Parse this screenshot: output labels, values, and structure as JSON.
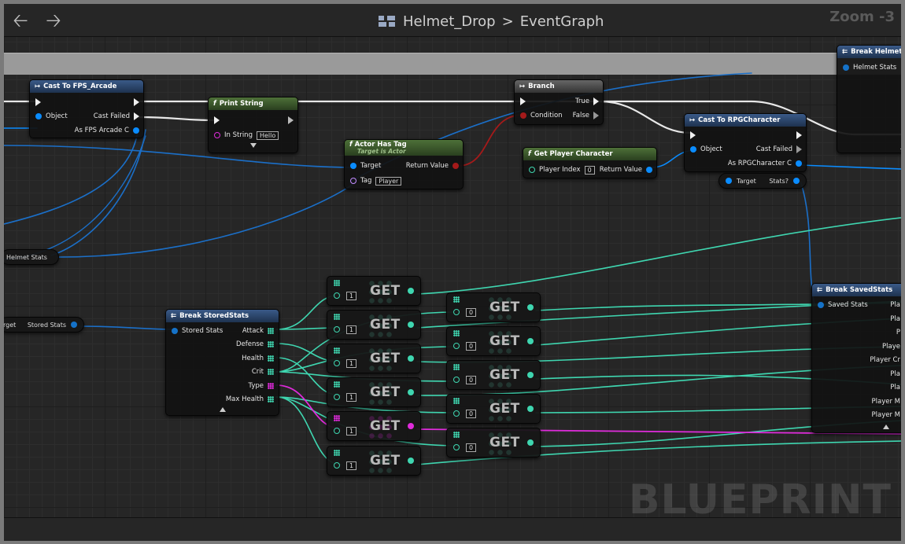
{
  "toolbar": {
    "back_icon": "back-arrow-icon",
    "forward_icon": "forward-arrow-icon",
    "graph_icon": "graph-icon",
    "asset_name": "Helmet_Drop",
    "separator": ">",
    "graph_name": "EventGraph",
    "zoom_label": "Zoom -3"
  },
  "colors": {
    "exec": "#f0f0f0",
    "object": "#0a8cff",
    "struct": "#1572c8",
    "integer": "#3fd6b0",
    "byte": "#e02bdc",
    "boolean": "#a51a1a",
    "string": "#e02bdc",
    "cast_header": "#2c4a74",
    "function_header": "#3e5b2e"
  },
  "nodes": {
    "cast_fps": {
      "title": "Cast To FPS_Arcade",
      "object": "Object",
      "cast_failed": "Cast Failed",
      "as_output": "As FPS Arcade C"
    },
    "print_string": {
      "title": "Print String",
      "in_string": "In String",
      "in_string_value": "Hello"
    },
    "actor_has_tag": {
      "title": "Actor Has Tag",
      "subtitle": "Target is Actor",
      "target": "Target",
      "return_value": "Return Value",
      "tag": "Tag",
      "tag_value": "Player"
    },
    "branch": {
      "title": "Branch",
      "condition": "Condition",
      "true_label": "True",
      "false_label": "False"
    },
    "get_player_character": {
      "title": "Get Player Character",
      "player_index": "Player Index",
      "player_index_value": "0",
      "return_value": "Return Value"
    },
    "cast_rpg": {
      "title": "Cast To RPGCharacter",
      "object": "Object",
      "cast_failed": "Cast Failed",
      "as_output": "As RPGCharacter C"
    },
    "break_helmet": {
      "title": "Break HelmetStat",
      "input": "Helmet Stats"
    },
    "break_stored": {
      "title": "Break StoredStats",
      "input": "Stored Stats",
      "outputs": [
        "Attack",
        "Defense",
        "Health",
        "Crit",
        "Type",
        "Max Health"
      ]
    },
    "break_saved": {
      "title": "Break SavedStats",
      "input": "Saved Stats",
      "outputs": [
        "Pla",
        "Pla",
        "P",
        "Playe",
        "Player Cr",
        "Pla",
        "Pla",
        "Player M",
        "Player M"
      ]
    }
  },
  "variables": {
    "target_stats": {
      "left": "Target",
      "right": "Stats?"
    },
    "helmet_stats": {
      "label": "Helmet Stats"
    },
    "stored_stats": {
      "left": "rget",
      "right": "Stored Stats"
    }
  },
  "get_nodes": {
    "label": "GET",
    "left_column": [
      "1",
      "1",
      "1",
      "1",
      "1",
      "1"
    ],
    "right_column": [
      "0",
      "0",
      "0",
      "0",
      "0"
    ]
  },
  "watermark": "BLUEPRINT"
}
